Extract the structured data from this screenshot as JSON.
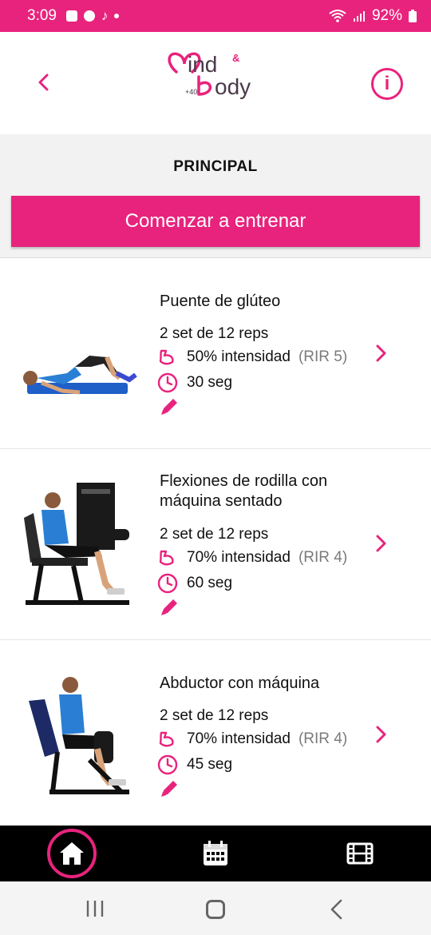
{
  "status_bar": {
    "time": "3:09",
    "battery": "92%"
  },
  "header": {
    "logo_text_top": "ind",
    "logo_amp": "&",
    "logo_text_bottom": "ody",
    "logo_age": "+40"
  },
  "section": {
    "title": "PRINCIPAL",
    "start_button": "Comenzar a entrenar"
  },
  "exercises": [
    {
      "title": "Puente de glúteo",
      "sets": "2 set de 12 reps",
      "intensity": "50% intensidad",
      "rir": "(RIR 5)",
      "time": "30 seg"
    },
    {
      "title": "Flexiones de rodilla con máquina sentado",
      "sets": "2 set de 12 reps",
      "intensity": "70% intensidad",
      "rir": "(RIR 4)",
      "time": "60 seg"
    },
    {
      "title": "Abductor con máquina",
      "sets": "2 set de 12 reps",
      "intensity": "70% intensidad",
      "rir": "(RIR 4)",
      "time": "45 seg"
    }
  ],
  "icons": {
    "back": "chevron-left-icon",
    "info": "info-icon",
    "muscle": "bicep-icon",
    "clock": "clock-icon",
    "edit": "pencil-icon",
    "next": "chevron-right-icon",
    "home": "home-icon",
    "calendar": "calendar-icon",
    "video": "film-icon"
  },
  "colors": {
    "accent": "#e8237d",
    "nav_bg": "#000000",
    "section_bg": "#f2f2f2"
  }
}
